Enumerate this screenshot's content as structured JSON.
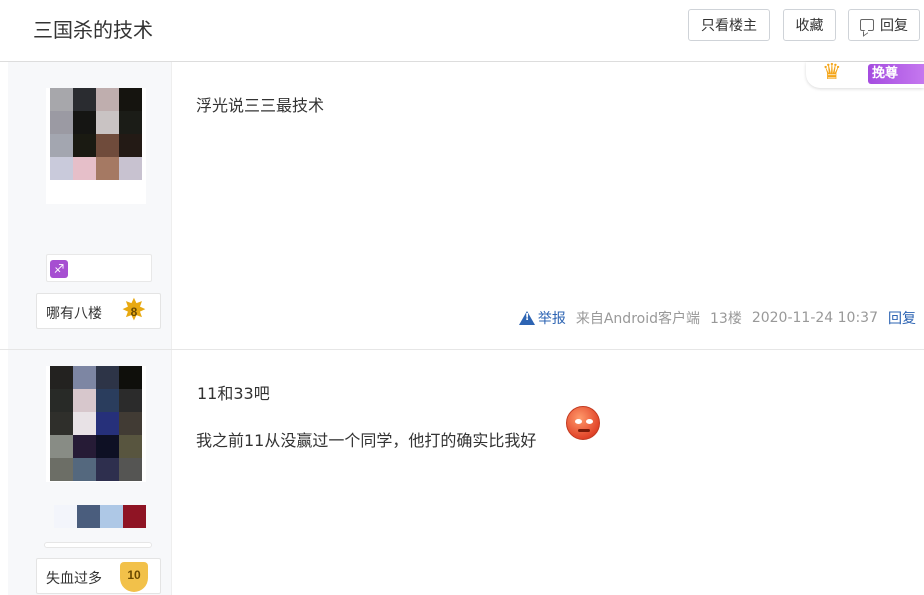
{
  "header": {
    "title": "三国杀的技术",
    "only_op_label": "只看楼主",
    "favorite_label": "收藏",
    "reply_label": "回复"
  },
  "posts": [
    {
      "user": {
        "level_name": "哪有八楼",
        "level": "8"
      },
      "content": [
        "浮光说三三最技术"
      ],
      "meta": {
        "report": "举报",
        "source": "来自Android客户端",
        "floor": "13楼",
        "time": "2020-11-24 10:37",
        "reply": "回复"
      }
    },
    {
      "user": {
        "level_name": "失血过多",
        "level": "10"
      },
      "content": [
        "11和33吧",
        "我之前11从没赢过一个同学，他打的确实比我好"
      ]
    }
  ],
  "vip_badge": "挽尊",
  "colors": {
    "link": "#2d64b3",
    "sidebar_bg": "#f7f8fa",
    "vip_purple": "#a54ce0"
  }
}
